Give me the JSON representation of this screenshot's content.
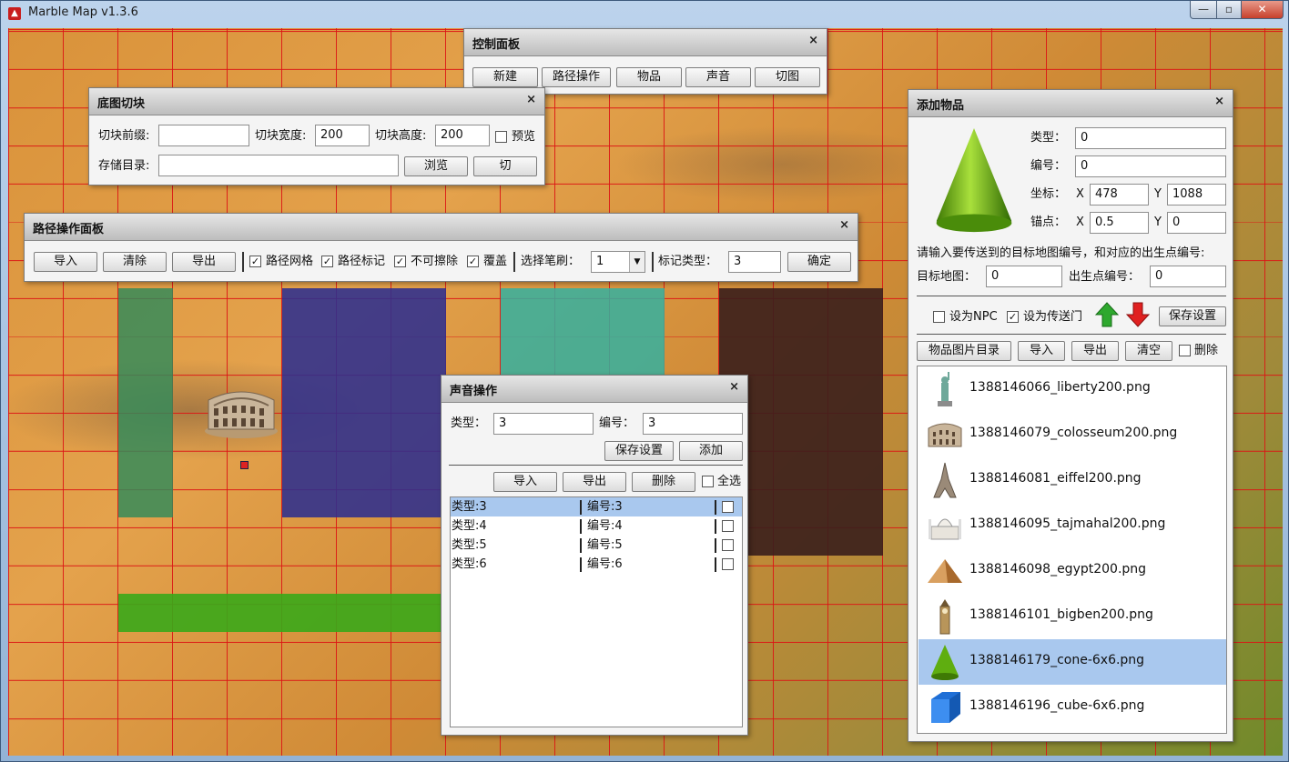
{
  "window": {
    "title": "Marble Map v1.3.6",
    "min": "—",
    "max": "▫",
    "close": "✕"
  },
  "control_panel": {
    "title": "控制面板",
    "close": "×",
    "buttons": [
      "新建",
      "路径操作",
      "物品",
      "声音",
      "切图"
    ]
  },
  "tile_panel": {
    "title": "底图切块",
    "close": "×",
    "prefix_label": "切块前缀:",
    "prefix_value": "",
    "width_label": "切块宽度:",
    "width_value": "200",
    "height_label": "切块高度:",
    "height_value": "200",
    "preview_label": "预览",
    "dir_label": "存储目录:",
    "dir_value": "",
    "browse": "浏览",
    "cut": "切"
  },
  "path_panel": {
    "title": "路径操作面板",
    "close": "×",
    "import": "导入",
    "clear": "清除",
    "export": "导出",
    "grid_label": "路径网格",
    "mark_label": "路径标记",
    "nowipe_label": "不可擦除",
    "cover_label": "覆盖",
    "brush_label": "选择笔刷：",
    "brush_value": "1",
    "marktype_label": "标记类型：",
    "marktype_value": "3",
    "ok": "确定"
  },
  "sound_panel": {
    "title": "声音操作",
    "close": "×",
    "type_label": "类型：",
    "type_value": "3",
    "id_label": "编号：",
    "id_value": "3",
    "save": "保存设置",
    "add": "添加",
    "import": "导入",
    "export": "导出",
    "delete": "删除",
    "selectall": "全选",
    "rows": [
      {
        "type": "类型:3",
        "id": "编号:3"
      },
      {
        "type": "类型:4",
        "id": "编号:4"
      },
      {
        "type": "类型:5",
        "id": "编号:5"
      },
      {
        "type": "类型:6",
        "id": "编号:6"
      }
    ]
  },
  "item_panel": {
    "title": "添加物品",
    "close": "×",
    "type_label": "类型：",
    "type_value": "0",
    "id_label": "编号：",
    "id_value": "0",
    "coord_label": "坐标：",
    "x_label": "X",
    "coord_x": "478",
    "y_label": "Y",
    "coord_y": "1088",
    "anchor_label": "锚点：",
    "anchor_x": "0.5",
    "anchor_y": "0",
    "prompt": "请输入要传送到的目标地图编号，和对应的出生点编号:",
    "target_label": "目标地图：",
    "target_value": "0",
    "spawn_label": "出生点编号：",
    "spawn_value": "0",
    "npc_label": "设为NPC",
    "portal_label": "设为传送门",
    "save": "保存设置",
    "imgdir": "物品图片目录",
    "import": "导入",
    "export": "导出",
    "clear": "清空",
    "delete_label": "删除",
    "files": [
      "1388146066_liberty200.png",
      "1388146079_colosseum200.png",
      "1388146081_eiffel200.png",
      "1388146095_tajmahal200.png",
      "1388146098_egypt200.png",
      "1388146101_bigben200.png",
      "1388146179_cone-6x6.png",
      "1388146196_cube-6x6.png"
    ]
  },
  "colors": {
    "grid": "#dc1414",
    "green_zone": "#2f8a5a",
    "navy_zone": "#2d2f8e",
    "teal_zone": "#35b0a0",
    "dark_zone": "#3a1e1c",
    "lime_zone": "#3aa81a",
    "selection": "#a9c8ee"
  }
}
